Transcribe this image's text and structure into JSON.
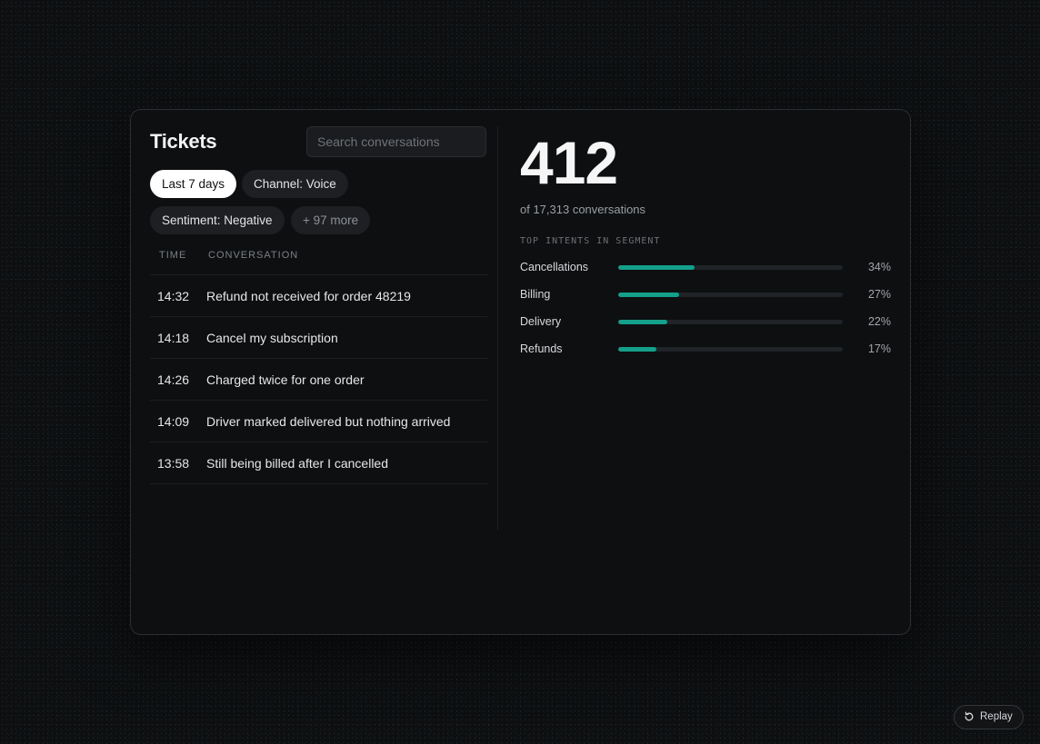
{
  "left": {
    "title": "Tickets",
    "search": {
      "placeholder": "Search conversations",
      "value": ""
    },
    "filters": [
      {
        "label": "Last 7 days",
        "active": true
      },
      {
        "label": "Channel: Voice",
        "active": false
      },
      {
        "label": "Sentiment: Negative",
        "active": false
      },
      {
        "label": "+ 97 more",
        "active": false
      }
    ],
    "columns": {
      "time": "TIME",
      "conversation": "CONVERSATION"
    },
    "rows": [
      {
        "time": "14:32",
        "text": "Refund not received for order 48219"
      },
      {
        "time": "14:18",
        "text": "Cancel my subscription"
      },
      {
        "time": "14:26",
        "text": "Charged twice for one order"
      },
      {
        "time": "14:09",
        "text": "Driver marked delivered but nothing arrived"
      },
      {
        "time": "13:58",
        "text": "Still being billed after I cancelled"
      }
    ]
  },
  "right": {
    "count": "412",
    "subtitle": "of 17,313 conversations",
    "section_label": "TOP INTENTS IN SEGMENT",
    "intents": [
      {
        "label": "Cancellations",
        "percent": 34,
        "display": "34%"
      },
      {
        "label": "Billing",
        "percent": 27,
        "display": "27%"
      },
      {
        "label": "Delivery",
        "percent": 22,
        "display": "22%"
      },
      {
        "label": "Refunds",
        "percent": 17,
        "display": "17%"
      }
    ],
    "accent_color": "#14a08a"
  },
  "replay": {
    "label": "Replay",
    "icon": "replay-icon"
  }
}
